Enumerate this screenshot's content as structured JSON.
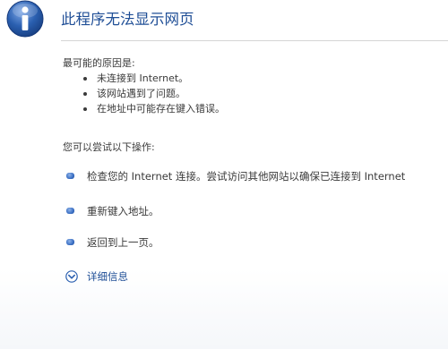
{
  "header": {
    "icon": "info-icon",
    "title": "此程序无法显示网页"
  },
  "causes": {
    "heading": "最可能的原因是:",
    "items": [
      "未连接到 Internet。",
      "该网站遇到了问题。",
      "在地址中可能存在键入错误。"
    ]
  },
  "actions": {
    "heading": "您可以尝试以下操作:",
    "items": [
      "检查您的 Internet 连接。尝试访问其他网站以确保已连接到 Internet",
      "重新键入地址。",
      "返回到上一页。"
    ]
  },
  "details": {
    "icon": "chevron-down-circle-icon",
    "label": "详细信息"
  },
  "colors": {
    "title": "#1f4e96",
    "icon_blue": "#2a5fb0",
    "text": "#3a3a3a"
  }
}
